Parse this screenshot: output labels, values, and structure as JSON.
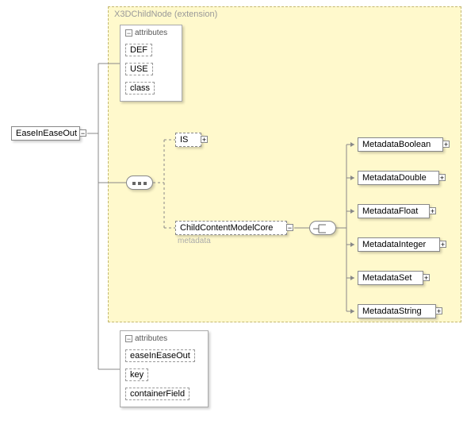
{
  "root": {
    "label": "EaseInEaseOut"
  },
  "extension": {
    "label": "X3DChildNode",
    "suffix": "(extension)"
  },
  "attrBox1": {
    "head": "attributes",
    "items": [
      "DEF",
      "USE",
      "class"
    ]
  },
  "is": {
    "label": "IS"
  },
  "childContent": {
    "label": "ChildContentModelCore",
    "caption": "metadata"
  },
  "metadata": [
    {
      "label": "MetadataBoolean"
    },
    {
      "label": "MetadataDouble"
    },
    {
      "label": "MetadataFloat"
    },
    {
      "label": "MetadataInteger"
    },
    {
      "label": "MetadataSet"
    },
    {
      "label": "MetadataString"
    }
  ],
  "attrBox2": {
    "head": "attributes",
    "items": [
      "easeInEaseOut",
      "key",
      "containerField"
    ]
  }
}
